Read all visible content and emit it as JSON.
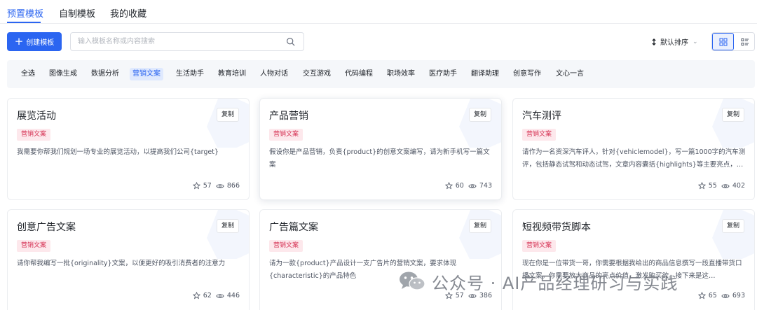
{
  "tabs": [
    {
      "label": "预置模板",
      "active": true
    },
    {
      "label": "自制模板",
      "active": false
    },
    {
      "label": "我的收藏",
      "active": false
    }
  ],
  "toolbar": {
    "create_label": "创建模板",
    "search_placeholder": "输入模板名称或内容搜索",
    "sort_label": "默认排序",
    "view_mode": "grid"
  },
  "categories": [
    {
      "label": "全选",
      "active": false
    },
    {
      "label": "图像生成",
      "active": false
    },
    {
      "label": "数据分析",
      "active": false
    },
    {
      "label": "营销文案",
      "active": true
    },
    {
      "label": "生活助手",
      "active": false
    },
    {
      "label": "教育培训",
      "active": false
    },
    {
      "label": "人物对话",
      "active": false
    },
    {
      "label": "交互游戏",
      "active": false
    },
    {
      "label": "代码编程",
      "active": false
    },
    {
      "label": "职场效率",
      "active": false
    },
    {
      "label": "医疗助手",
      "active": false
    },
    {
      "label": "翻译助理",
      "active": false
    },
    {
      "label": "创意写作",
      "active": false
    },
    {
      "label": "文心一言",
      "active": false
    }
  ],
  "cards": [
    {
      "title": "展览活动",
      "copy_label": "复制",
      "tag": "营销文案",
      "desc": "我需要你帮我们规划一场专业的展览活动，以提高我们公司{target}",
      "likes": "57",
      "views": "866"
    },
    {
      "title": "产品营销",
      "copy_label": "复制",
      "tag": "营销文案",
      "desc": "假设你是产品营销，负责{product}的创意文案编写，请为新手机写一篇文案",
      "likes": "60",
      "views": "743"
    },
    {
      "title": "汽车测评",
      "copy_label": "复制",
      "tag": "营销文案",
      "desc": "请作为一名资深汽车评人，针对{vehiclemodel}，写一篇1000字的汽车测评，包括静态试驾和动态试驾，文章内容囊括{highlights}等主要亮点，…",
      "likes": "55",
      "views": "402"
    },
    {
      "title": "创意广告文案",
      "copy_label": "复制",
      "tag": "营销文案",
      "desc": "请你帮我编写一批{originality}文案，以便更好的吸引消费者的注意力",
      "likes": "62",
      "views": "446"
    },
    {
      "title": "广告篇文案",
      "copy_label": "复制",
      "tag": "营销文案",
      "desc": "请为一款{product}产品设计一支广告片的营销文案，要求体现{characteristic}的产品特色",
      "likes": "57",
      "views": "386"
    },
    {
      "title": "短视频带货脚本",
      "copy_label": "复制",
      "tag": "营销文案",
      "desc": "现在你是一位带货一哥，你需要根据我给出的商品信息撰写一段直播带货口播文案。你需要放大商品的亮点价值，激发购买欲。接下来是这…",
      "likes": "65",
      "views": "693"
    }
  ],
  "watermark": {
    "text": "公众号 · AI产品经理研习与实践",
    "icon": "wechat-icon"
  },
  "colors": {
    "accent": "#2b65f1",
    "tag_bg": "#fde8ec",
    "tag_text": "#d63355",
    "category_bg": "#f5f7fa"
  }
}
